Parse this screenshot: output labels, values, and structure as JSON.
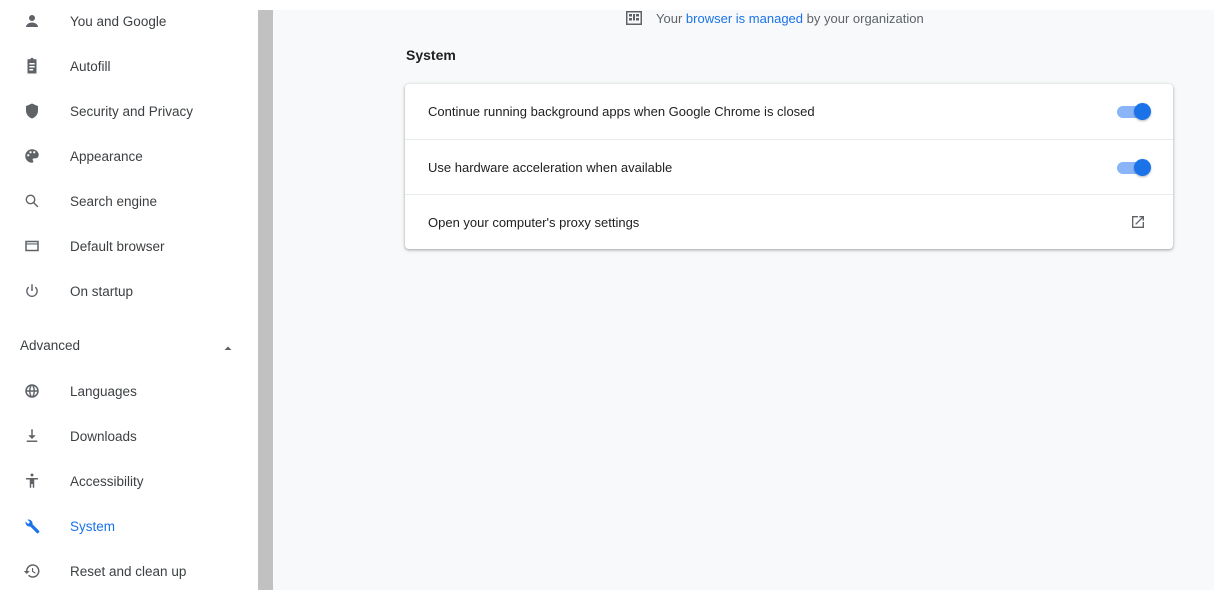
{
  "sidebar": {
    "items": [
      {
        "label": "You and Google",
        "icon": "person-icon"
      },
      {
        "label": "Autofill",
        "icon": "clipboard-icon"
      },
      {
        "label": "Security and Privacy",
        "icon": "shield-icon"
      },
      {
        "label": "Appearance",
        "icon": "palette-icon"
      },
      {
        "label": "Search engine",
        "icon": "search-icon"
      },
      {
        "label": "Default browser",
        "icon": "browser-window-icon"
      },
      {
        "label": "On startup",
        "icon": "power-icon"
      }
    ],
    "advanced": {
      "label": "Advanced",
      "icon": "chevron-up-icon",
      "expanded": true
    },
    "advanced_items": [
      {
        "label": "Languages",
        "icon": "globe-icon"
      },
      {
        "label": "Downloads",
        "icon": "download-icon"
      },
      {
        "label": "Accessibility",
        "icon": "accessibility-icon"
      },
      {
        "label": "System",
        "icon": "wrench-icon",
        "selected": true
      },
      {
        "label": "Reset and clean up",
        "icon": "restore-icon"
      }
    ]
  },
  "managed_notice": {
    "prefix": "Your",
    "link1": "browser",
    "middle": "is",
    "link2": "managed",
    "suffix": "by your organization",
    "icon": "building-icon"
  },
  "section": {
    "title": "System",
    "rows": [
      {
        "label": "Continue running background apps when Google Chrome is closed",
        "control": "toggle",
        "checked": true
      },
      {
        "label": "Use hardware acceleration when available",
        "control": "toggle",
        "checked": true
      },
      {
        "label": "Open your computer's proxy settings",
        "control": "external-link-icon"
      }
    ]
  },
  "colors": {
    "accent": "#1a73e8",
    "toggle_track": "#8ab4f8",
    "page_background": "#f8f9fa",
    "text_secondary": "#5f6368"
  }
}
